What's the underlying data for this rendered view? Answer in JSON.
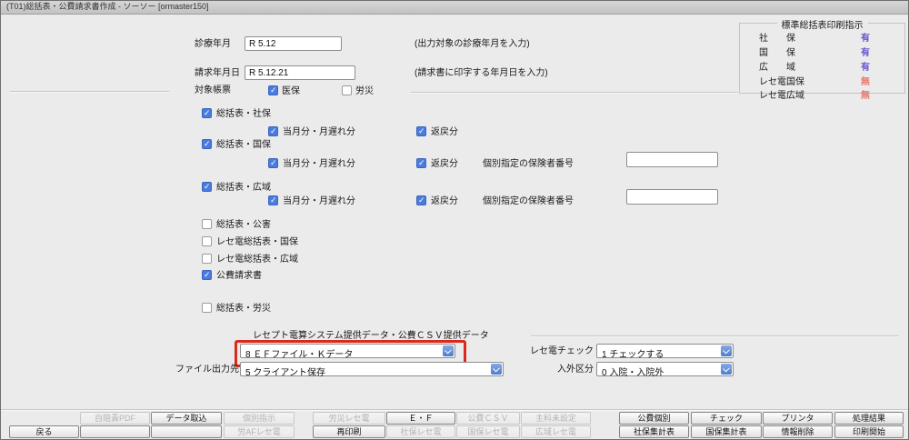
{
  "title_bar": {
    "title": "(T01)総括表・公費請求書作成 - ソーソー [ormaster150]"
  },
  "print_box": {
    "legend": "標準総括表印刷指示",
    "items": [
      {
        "label": "社　　保",
        "value": "有",
        "state": "yes"
      },
      {
        "label": "国　　保",
        "value": "有",
        "state": "yes"
      },
      {
        "label": "広　　域",
        "value": "有",
        "state": "yes"
      },
      {
        "label": "レセ電国保",
        "value": "無",
        "state": "no"
      },
      {
        "label": "レセ電広域",
        "value": "無",
        "state": "no"
      }
    ]
  },
  "fields": {
    "treatment_month": {
      "label": "診療年月",
      "value": "R 5.12",
      "hint": "(出力対象の診療年月を入力)"
    },
    "billing_date": {
      "label": "請求年月日",
      "value": "R 5.12.21",
      "hint": "(請求書に印字する年月日を入力)"
    },
    "target_forms": {
      "label": "対象帳票",
      "options": [
        {
          "label": "医保",
          "checked": true
        },
        {
          "label": "労災",
          "checked": false
        }
      ]
    }
  },
  "sections": [
    {
      "label": "総括表・社保",
      "checked": true,
      "monthly_label": "当月分・月遅れ分",
      "monthly_checked": true,
      "return_label": "返戻分",
      "return_checked": true
    },
    {
      "label": "総括表・国保",
      "checked": true,
      "monthly_label": "当月分・月遅れ分",
      "monthly_checked": true,
      "return_label": "返戻分",
      "return_checked": true,
      "insurer_label": "個別指定の保険者番号",
      "insurer_value": ""
    },
    {
      "label": "総括表・広域",
      "checked": true,
      "monthly_label": "当月分・月遅れ分",
      "monthly_checked": true,
      "return_label": "返戻分",
      "return_checked": true,
      "insurer_label": "個別指定の保険者番号",
      "insurer_value": ""
    }
  ],
  "singles": [
    {
      "label": "総括表・公害",
      "checked": false
    },
    {
      "label": "レセ電総括表・国保",
      "checked": false
    },
    {
      "label": "レセ電総括表・広域",
      "checked": false
    },
    {
      "label": "公費請求書",
      "checked": true
    },
    {
      "label": "総括表・労災",
      "checked": false
    }
  ],
  "csv": {
    "group_label": "レセプト電算システム提供データ・公費ＣＳＶ提供データ",
    "provide_value": "8 ＥＦファイル・Ｋデータ",
    "output_label": "ファイル出力先",
    "output_value": "5 クライアント保存",
    "check_label": "レセ電チェック",
    "check_value": "1 チェックする",
    "nyugai_label": "入外区分",
    "nyugai_value": "0 入院・入院外"
  },
  "buttons": {
    "row1": [
      {
        "label": "自賠責PDF",
        "enabled": false
      },
      {
        "label": "データ取込",
        "enabled": true
      },
      {
        "label": "個別指示",
        "enabled": false
      },
      {
        "label": "労災レセ電",
        "enabled": false
      },
      {
        "label": "Ｅ・Ｆ",
        "enabled": true
      },
      {
        "label": "公費ＣＳＶ",
        "enabled": false
      },
      {
        "label": "主科未設定",
        "enabled": false
      },
      {
        "label": "公費個別",
        "enabled": true
      },
      {
        "label": "チェック",
        "enabled": true
      },
      {
        "label": "プリンタ",
        "enabled": true
      },
      {
        "label": "処理結果",
        "enabled": true
      }
    ],
    "row2": [
      {
        "label": "戻る",
        "enabled": true
      },
      {
        "label": "",
        "enabled": true
      },
      {
        "label": "",
        "enabled": true
      },
      {
        "label": "労AFレセ電",
        "enabled": false
      },
      {
        "label": "再印刷",
        "enabled": true
      },
      {
        "label": "社保レセ電",
        "enabled": false
      },
      {
        "label": "国保レセ電",
        "enabled": false
      },
      {
        "label": "広域レセ電",
        "enabled": false
      },
      {
        "label": "社保集計表",
        "enabled": true
      },
      {
        "label": "国保集計表",
        "enabled": true
      },
      {
        "label": "情報削除",
        "enabled": true
      },
      {
        "label": "印刷開始",
        "enabled": true
      }
    ]
  },
  "colors": {
    "checkbox_blue": "#4a7cdf",
    "combo_button_blue": "#5d8ad8",
    "yes_purple": "#6655cc",
    "no_red": "#e8796f",
    "highlight_red": "#d92a1e"
  }
}
